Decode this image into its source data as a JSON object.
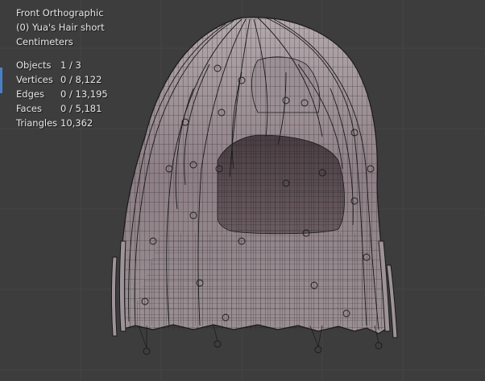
{
  "viewport": {
    "view_name": "Front Orthographic",
    "object_line": "(0) Yua's Hair short",
    "units": "Centimeters"
  },
  "stats": [
    {
      "label": "Objects",
      "value": "1 / 3"
    },
    {
      "label": "Vertices",
      "value": "0 / 8,122"
    },
    {
      "label": "Edges",
      "value": "0 / 13,195"
    },
    {
      "label": "Faces",
      "value": "0 / 5,181"
    },
    {
      "label": "Triangles",
      "value": "10,362"
    }
  ],
  "colors": {
    "background": "#3d3d3d",
    "mesh_fill": "#8a7a80",
    "wire": "#1a1a1a",
    "text": "#e6e6e6",
    "active_marker": "#4a7fc4"
  }
}
